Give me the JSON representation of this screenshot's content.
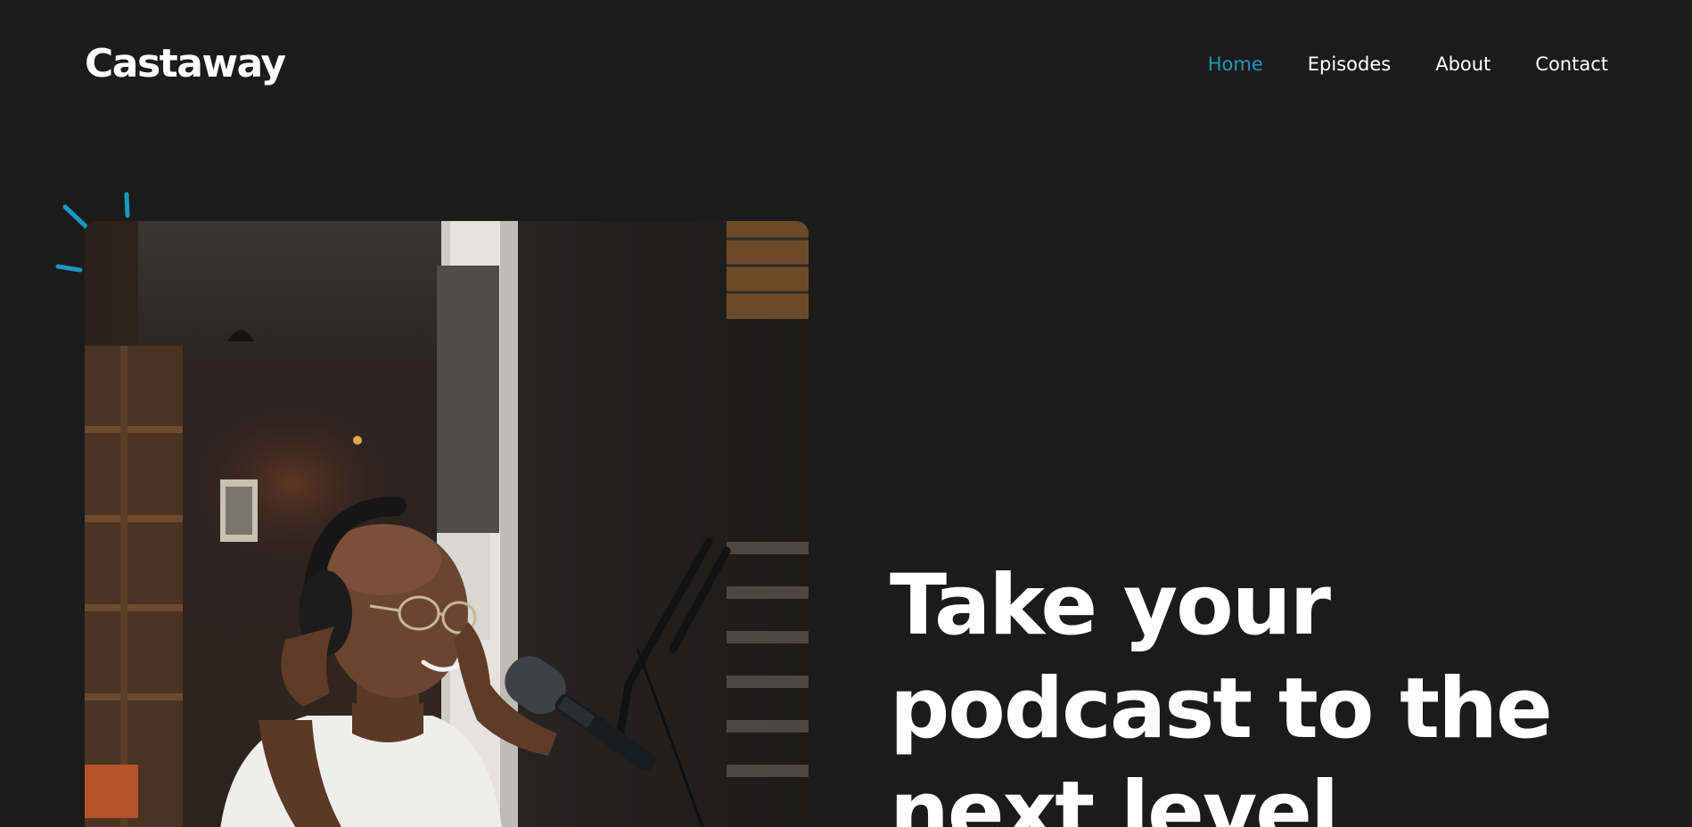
{
  "brand": {
    "name": "Castaway",
    "accent_color": "#1a98c0",
    "background_color": "#1b1b1b"
  },
  "nav": {
    "items": [
      {
        "label": "Home",
        "active": true
      },
      {
        "label": "Episodes",
        "active": false
      },
      {
        "label": "About",
        "active": false
      },
      {
        "label": "Contact",
        "active": false
      }
    ]
  },
  "hero": {
    "headline_lines": [
      "Take your",
      "podcast to the",
      "next level"
    ],
    "image": {
      "subject": "podcast-host-photo"
    },
    "decoration": "sparkle-icon"
  }
}
